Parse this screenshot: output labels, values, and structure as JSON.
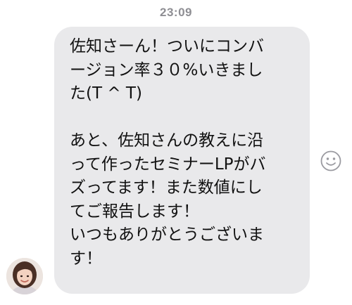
{
  "header": {
    "timestamp": "23:09"
  },
  "message": {
    "lines": [
      "佐知さーん！ついにコンバ",
      "ージョン率３０%いきまし",
      "た(T ^ T)",
      "",
      "あと、佐知さんの教えに沿",
      "って作ったセミナーLPがバ",
      "ズってます！また数値にし",
      "てご報告します！",
      "いつもありがとうございま",
      "す！"
    ]
  },
  "icons": {
    "reaction": "smiley-icon",
    "avatar": "avatar"
  },
  "colors": {
    "bubble": "#e9e9eb",
    "timestamp": "#8e8e93",
    "text": "#111111"
  }
}
